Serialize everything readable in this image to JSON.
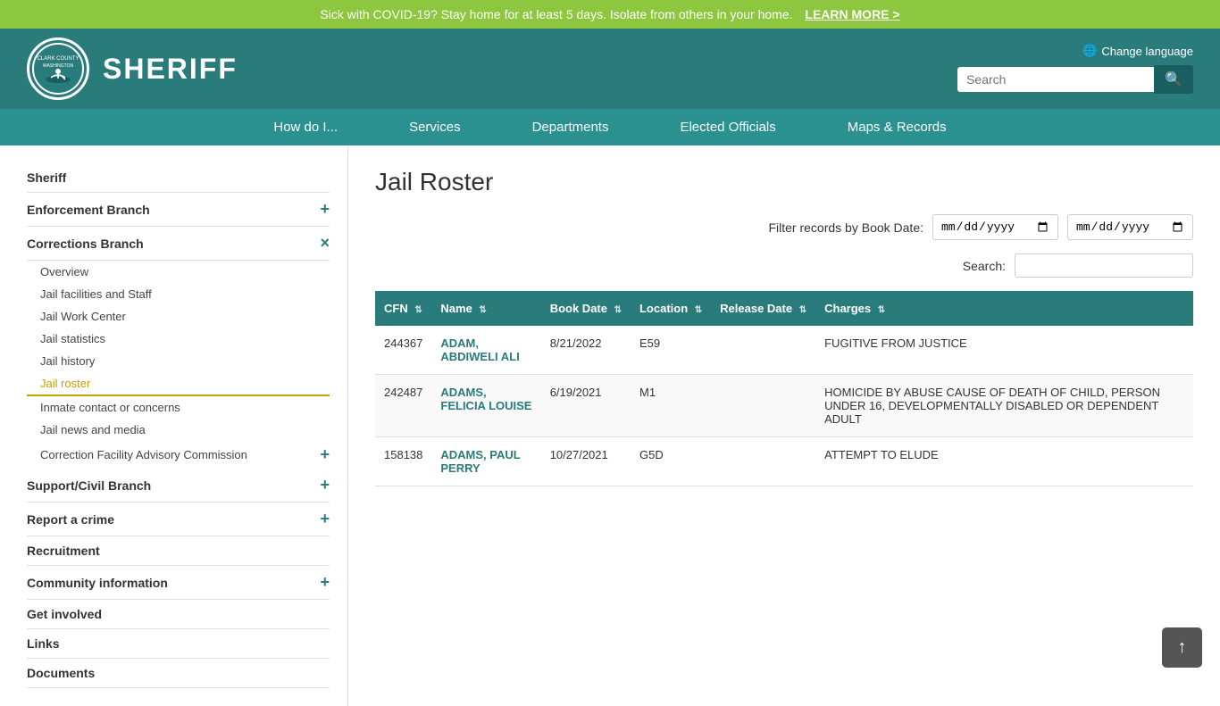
{
  "covid_banner": {
    "message": "Sick with COVID-19? Stay home for at least 5 days. Isolate from others in your home.",
    "link_text": "LEARN MORE >"
  },
  "header": {
    "title": "SHERIFF",
    "change_language": "Change language",
    "search_placeholder": "Search"
  },
  "nav": {
    "items": [
      {
        "label": "How do I..."
      },
      {
        "label": "Services"
      },
      {
        "label": "Departments"
      },
      {
        "label": "Elected Officials"
      },
      {
        "label": "Maps & Records"
      }
    ]
  },
  "sidebar": {
    "items": [
      {
        "label": "Sheriff",
        "level": "top",
        "toggle": null
      },
      {
        "label": "Enforcement Branch",
        "level": "top",
        "toggle": "+"
      },
      {
        "label": "Corrections Branch",
        "level": "top",
        "toggle": "×"
      },
      {
        "label": "Overview",
        "level": "sub"
      },
      {
        "label": "Jail facilities and Staff",
        "level": "sub"
      },
      {
        "label": "Jail Work Center",
        "level": "sub"
      },
      {
        "label": "Jail statistics",
        "level": "sub"
      },
      {
        "label": "Jail history",
        "level": "sub"
      },
      {
        "label": "Jail roster",
        "level": "sub",
        "active": true
      },
      {
        "label": "Inmate contact or concerns",
        "level": "sub"
      },
      {
        "label": "Jail news and media",
        "level": "sub"
      },
      {
        "label": "Correction Facility Advisory Commission",
        "level": "sub",
        "toggle": "+"
      },
      {
        "label": "Support/Civil Branch",
        "level": "top",
        "toggle": "+"
      },
      {
        "label": "Report a crime",
        "level": "top",
        "toggle": "+"
      },
      {
        "label": "Recruitment",
        "level": "top",
        "toggle": null
      },
      {
        "label": "Community information",
        "level": "top",
        "toggle": "+"
      },
      {
        "label": "Get involved",
        "level": "top",
        "toggle": null
      },
      {
        "label": "Links",
        "level": "top",
        "toggle": null
      },
      {
        "label": "Documents",
        "level": "top",
        "toggle": null
      }
    ]
  },
  "main": {
    "page_title": "Jail Roster",
    "filter_label": "Filter records by Book Date:",
    "search_label": "Search:",
    "table": {
      "columns": [
        {
          "key": "cfn",
          "label": "CFN"
        },
        {
          "key": "name",
          "label": "Name"
        },
        {
          "key": "book_date",
          "label": "Book Date"
        },
        {
          "key": "location",
          "label": "Location"
        },
        {
          "key": "release_date",
          "label": "Release Date"
        },
        {
          "key": "charges",
          "label": "Charges"
        }
      ],
      "rows": [
        {
          "cfn": "244367",
          "name": "ADAM, ABDIWELI ALI",
          "book_date": "8/21/2022",
          "location": "E59",
          "release_date": "",
          "charges": "FUGITIVE FROM JUSTICE"
        },
        {
          "cfn": "242487",
          "name": "ADAMS, FELICIA LOUISE",
          "book_date": "6/19/2021",
          "location": "M1",
          "release_date": "",
          "charges": "HOMICIDE BY ABUSE CAUSE OF DEATH OF CHILD, PERSON UNDER 16, DEVELOPMENTALLY DISABLED OR DEPENDENT ADULT"
        },
        {
          "cfn": "158138",
          "name": "ADAMS, PAUL PERRY",
          "book_date": "10/27/2021",
          "location": "G5D",
          "release_date": "",
          "charges": "ATTEMPT TO ELUDE"
        }
      ]
    }
  }
}
